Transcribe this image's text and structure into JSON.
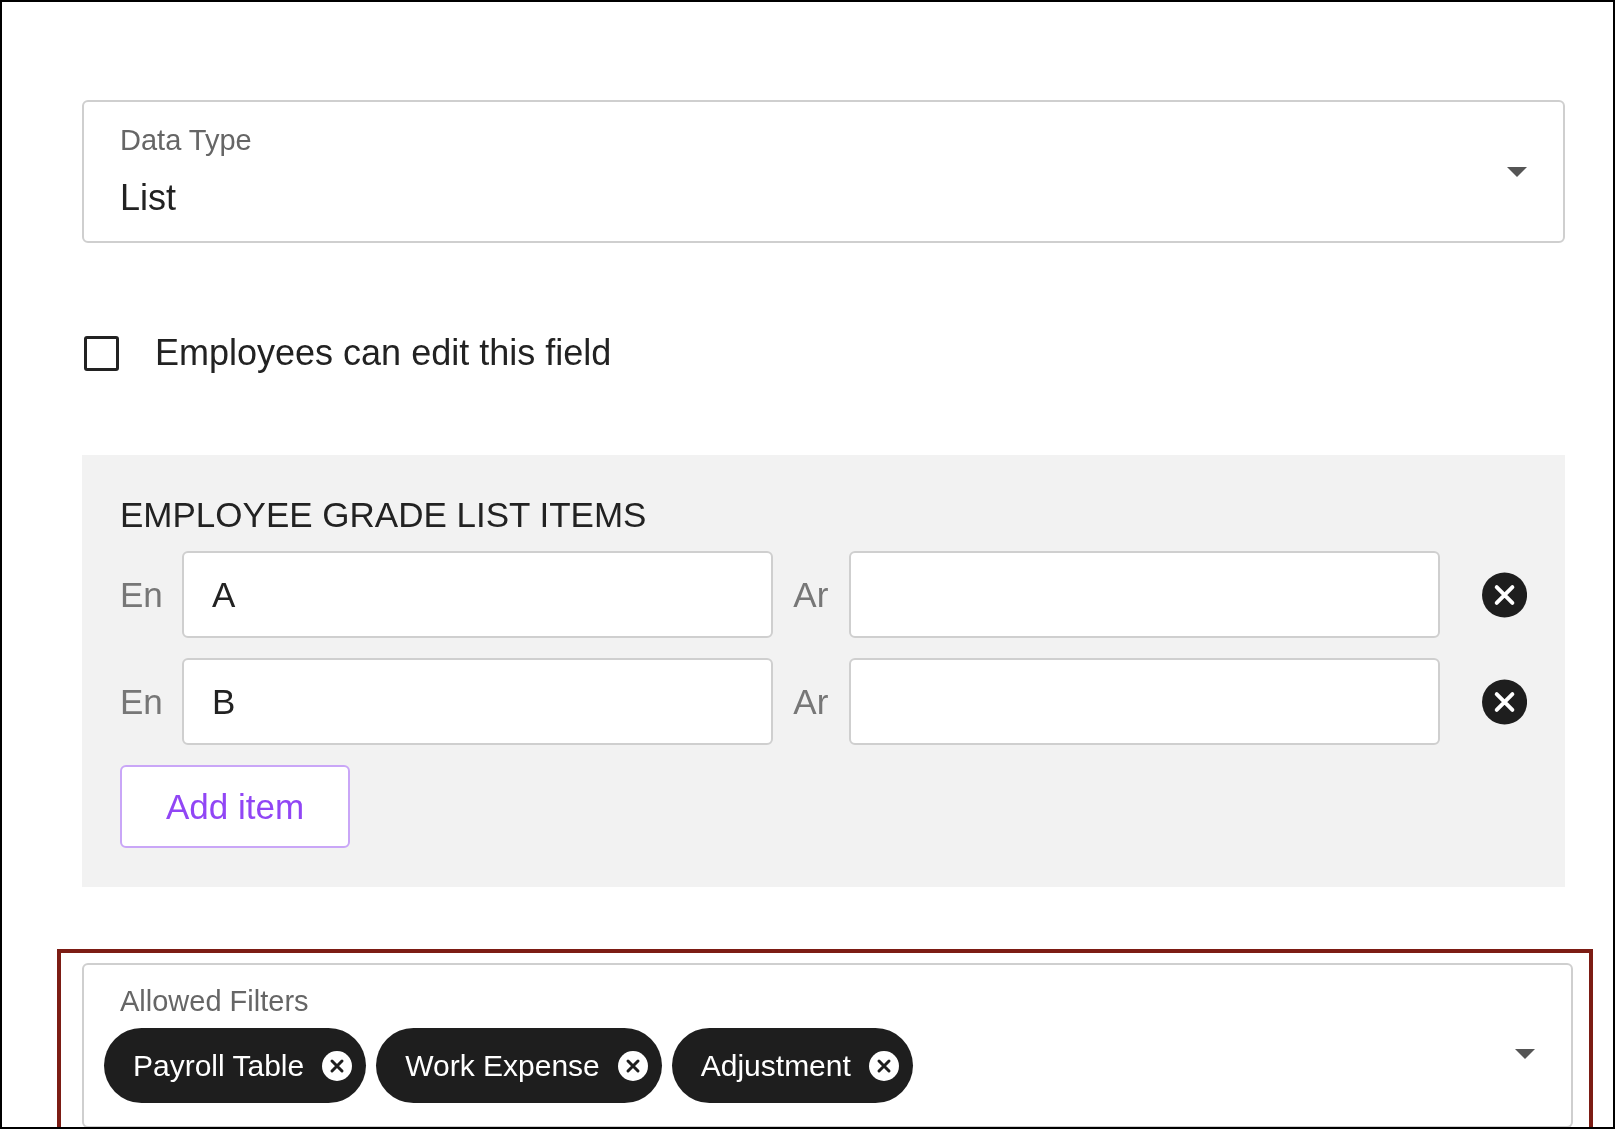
{
  "data_type": {
    "label": "Data Type",
    "value": "List"
  },
  "employee_edit": {
    "label": "Employees can edit this field",
    "checked": false
  },
  "list_items": {
    "title": "EMPLOYEE GRADE LIST ITEMS",
    "rows": [
      {
        "en_label": "En",
        "en_value": "A",
        "ar_label": "Ar",
        "ar_value": ""
      },
      {
        "en_label": "En",
        "en_value": "B",
        "ar_label": "Ar",
        "ar_value": ""
      }
    ],
    "add_button": "Add item"
  },
  "allowed_filters": {
    "label": "Allowed Filters",
    "highlighted": true,
    "chips": [
      {
        "label": "Payroll Table"
      },
      {
        "label": "Work Expense"
      },
      {
        "label": "Adjustment"
      }
    ]
  }
}
